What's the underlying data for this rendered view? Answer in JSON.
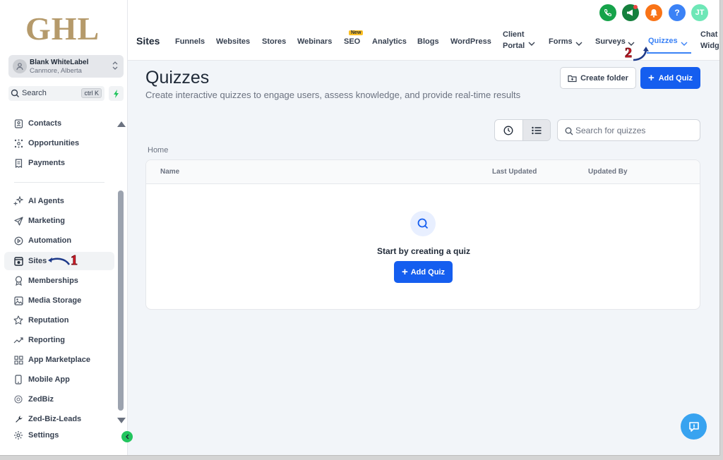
{
  "sidebar": {
    "logo": "GHL",
    "account": {
      "name": "Blank WhiteLabel",
      "location": "Canmore, Alberta"
    },
    "search": {
      "label": "Search",
      "shortcut": "ctrl K"
    },
    "items": [
      {
        "label": "Contacts",
        "icon": "contacts-icon"
      },
      {
        "label": "Opportunities",
        "icon": "opportunities-icon"
      },
      {
        "label": "Payments",
        "icon": "payments-icon"
      },
      {
        "label": "AI Agents",
        "icon": "sparkle-icon"
      },
      {
        "label": "Marketing",
        "icon": "send-icon"
      },
      {
        "label": "Automation",
        "icon": "play-icon"
      },
      {
        "label": "Sites",
        "icon": "globe-icon",
        "active": true
      },
      {
        "label": "Memberships",
        "icon": "badge-icon"
      },
      {
        "label": "Media Storage",
        "icon": "image-icon"
      },
      {
        "label": "Reputation",
        "icon": "star-icon"
      },
      {
        "label": "Reporting",
        "icon": "chart-icon"
      },
      {
        "label": "App Marketplace",
        "icon": "grid-icon"
      },
      {
        "label": "Mobile App",
        "icon": "phone-icon"
      },
      {
        "label": "ZedBiz",
        "icon": "zedbiz-icon"
      },
      {
        "label": "Zed-Biz-Leads",
        "icon": "wrench-icon"
      },
      {
        "label": "Settings",
        "icon": "gear-icon"
      }
    ]
  },
  "topbar": {
    "title": "Sites",
    "tabs": [
      {
        "label": "Funnels"
      },
      {
        "label": "Websites"
      },
      {
        "label": "Stores"
      },
      {
        "label": "Webinars"
      },
      {
        "label": "SEO",
        "badge": "New"
      },
      {
        "label": "Analytics"
      },
      {
        "label": "Blogs"
      },
      {
        "label": "WordPress"
      },
      {
        "label": "Client",
        "label2": "Portal"
      },
      {
        "label": "Forms"
      },
      {
        "label": "Surveys"
      },
      {
        "label": "Quizzes",
        "active": true
      },
      {
        "label": "Chat",
        "label2": "Widg"
      }
    ],
    "avatar_initials": "JT",
    "help_label": "?",
    "colors": {
      "phone": "#16a34a",
      "megaphone": "#15803d",
      "bell": "#f97316",
      "help": "#3b82f6",
      "avatar": "#6ee7b7"
    }
  },
  "main": {
    "title": "Quizzes",
    "subtitle": "Create interactive quizzes to engage users, assess knowledge, and provide real-time results",
    "create_folder_label": "Create folder",
    "add_quiz_label": "Add Quiz",
    "search_placeholder": "Search for quizzes",
    "breadcrumb": "Home",
    "columns": [
      "Name",
      "Last Updated",
      "Updated By"
    ],
    "empty_text": "Start by creating a quiz",
    "empty_button_label": "Add Quiz"
  },
  "annotations": {
    "marker1": "1",
    "marker2": "2"
  },
  "colors": {
    "primary": "#155eef",
    "accent": "#3b82f6",
    "marker": "#e11d2b"
  }
}
